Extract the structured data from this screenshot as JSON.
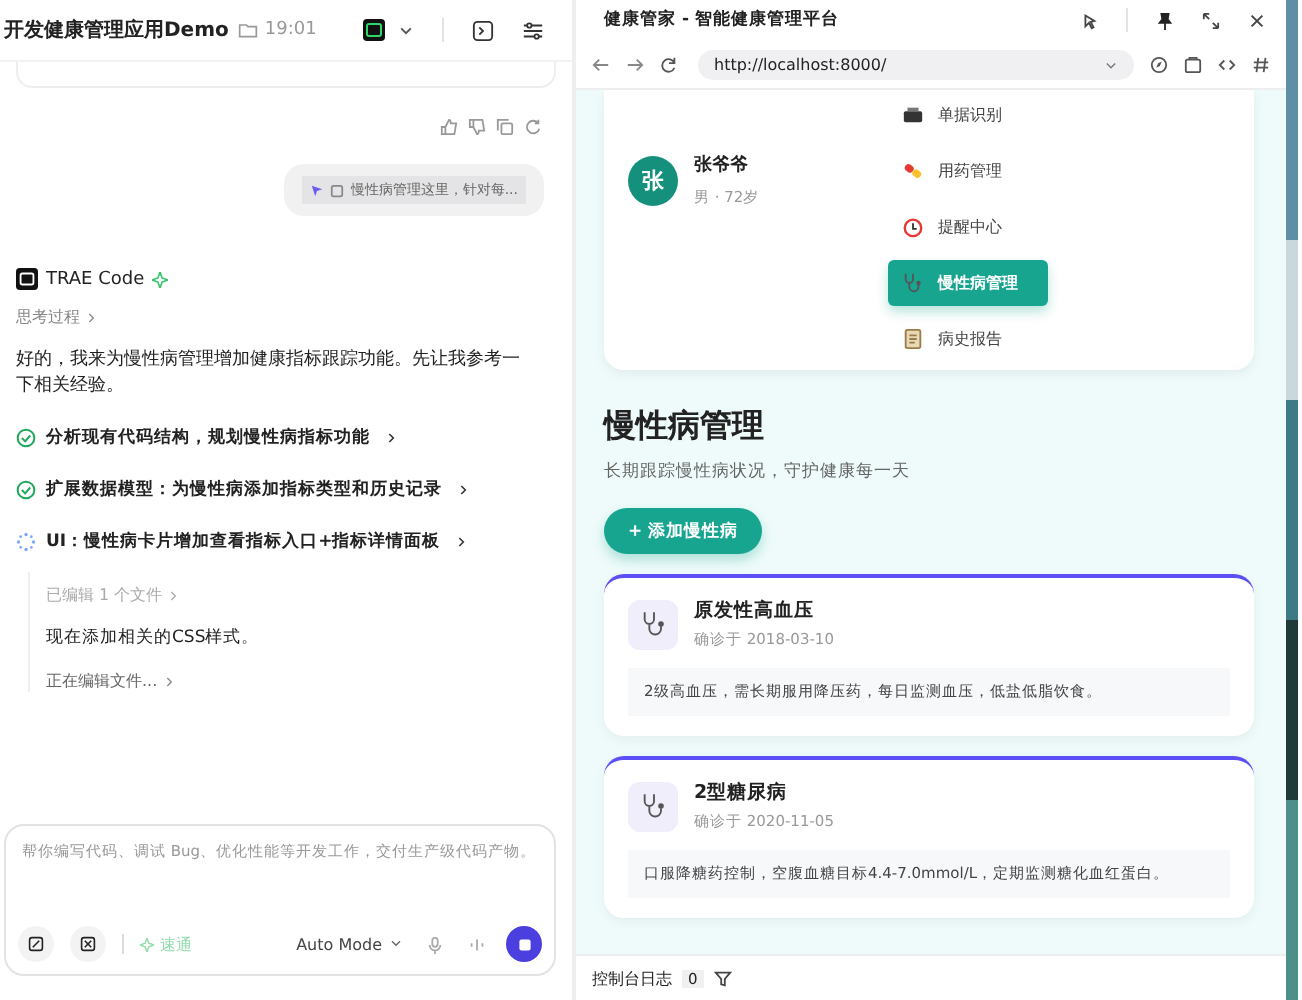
{
  "left": {
    "title": "开发健康管理应用Demo",
    "time": "19:01",
    "user_message": "慢性病管理这里，针对每...",
    "assistant": {
      "name": "TRAE Code",
      "thinking": "思考过程",
      "intro": "好的，我来为慢性病管理增加健康指标跟踪功能。先让我参考一下相关经验。",
      "steps": [
        {
          "text": "分析现有代码结构，规划慢性病指标功能",
          "done": true
        },
        {
          "text": "扩展数据模型：为慢性病添加指标类型和历史记录",
          "done": true
        },
        {
          "text": "UI：慢性病卡片增加查看指标入口+指标详情面板",
          "done": false
        }
      ],
      "edited": "已编辑 1 个文件",
      "note": "现在添加相关的CSS样式。",
      "editing": "正在编辑文件..."
    },
    "input": {
      "placeholder": "帮你编写代码、调试 Bug、优化性能等开发工作，交付生产级代码产物。",
      "speed_label": "速通",
      "mode": "Auto Mode"
    }
  },
  "browser": {
    "title": "健康管家 - 智能健康管理平台",
    "url": "http://localhost:8000/",
    "profile": {
      "avatar": "张",
      "name": "张爷爷",
      "meta": "男 · 72岁"
    },
    "menu": [
      {
        "label": "单据识别",
        "selected": false
      },
      {
        "label": "用药管理",
        "selected": false
      },
      {
        "label": "提醒中心",
        "selected": false
      },
      {
        "label": "慢性病管理",
        "selected": true
      },
      {
        "label": "病史报告",
        "selected": false
      }
    ],
    "page": {
      "heading": "慢性病管理",
      "subtitle": "长期跟踪慢性病状况，守护健康每一天",
      "add_button": "+ 添加慢性病",
      "conditions": [
        {
          "name": "原发性高血压",
          "diagnosed": "确诊于 2018-03-10",
          "note": "2级高血压，需长期服用降压药，每日监测血压，低盐低脂饮食。"
        },
        {
          "name": "2型糖尿病",
          "diagnosed": "确诊于 2020-11-05",
          "note": "口服降糖药控制，空腹血糖目标4.4-7.0mmol/L，定期监测糖化血红蛋白。"
        }
      ]
    },
    "console": {
      "label": "控制台日志",
      "count": "0"
    }
  }
}
